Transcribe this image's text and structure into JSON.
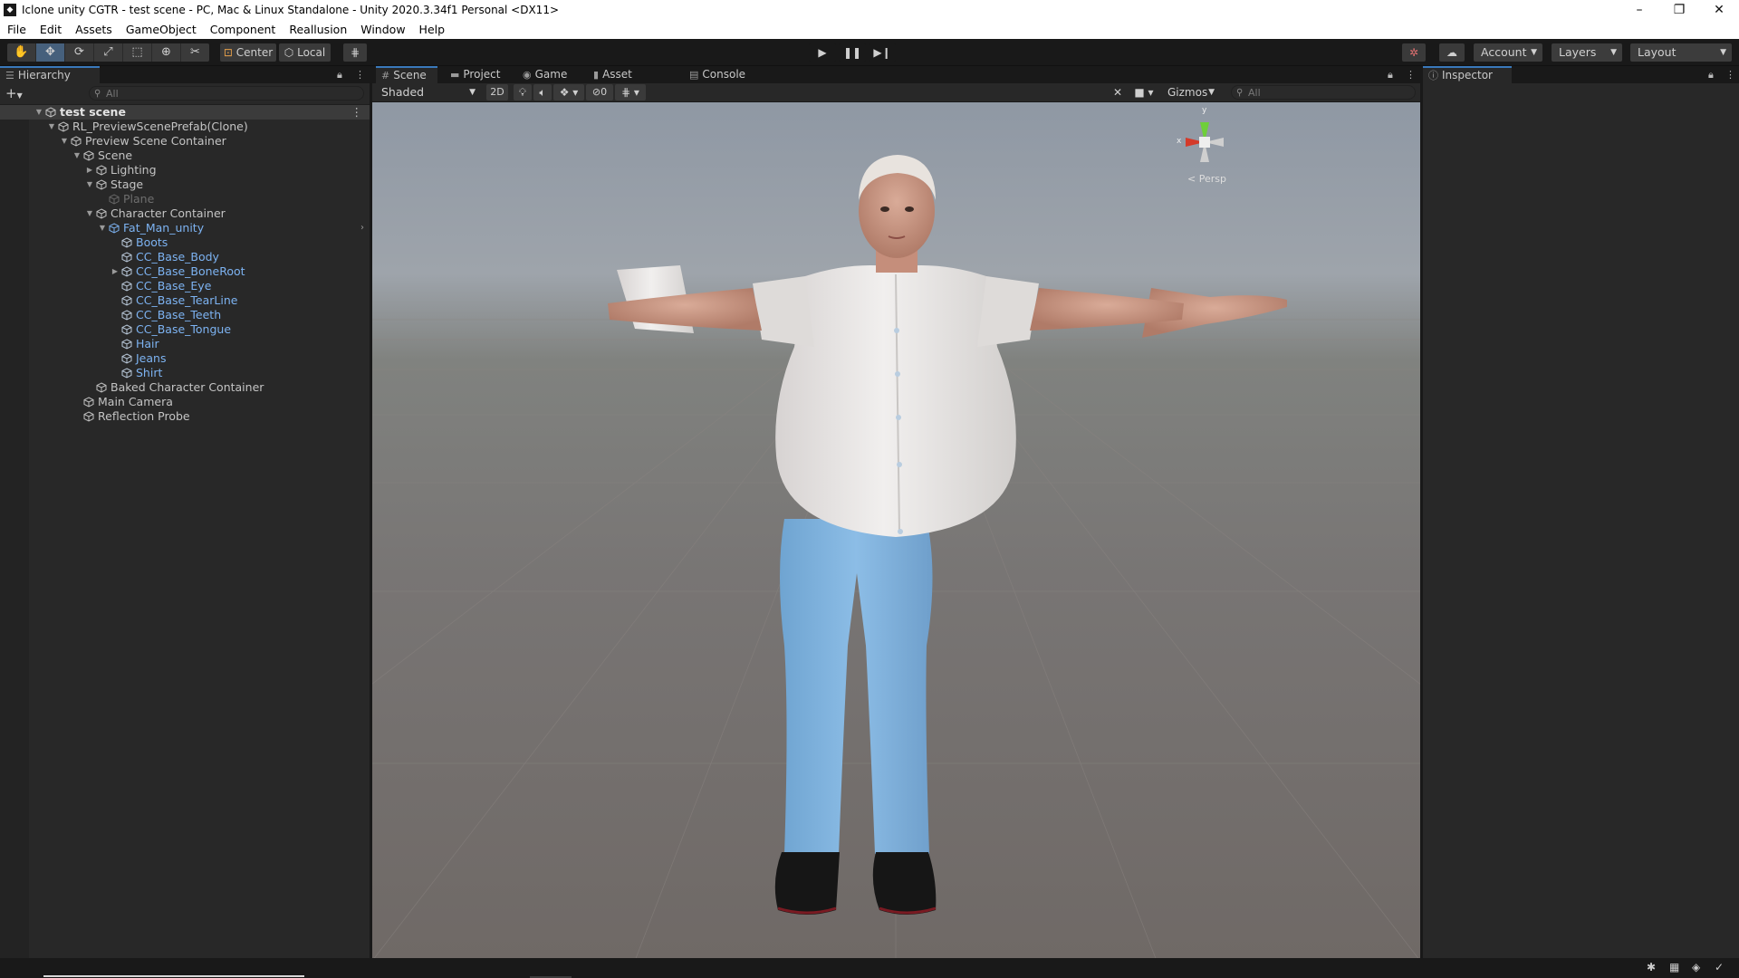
{
  "window": {
    "title": "Iclone unity CGTR - test scene - PC, Mac & Linux Standalone - Unity 2020.3.34f1 Personal <DX11>",
    "controls": [
      "–",
      "❐",
      "✕"
    ]
  },
  "menu": [
    "File",
    "Edit",
    "Assets",
    "GameObject",
    "Component",
    "Reallusion",
    "Window",
    "Help"
  ],
  "toolbar": {
    "pivot_label": "Center",
    "space_label": "Local",
    "account_label": "Account",
    "layers_label": "Layers",
    "layout_label": "Layout"
  },
  "hierarchy": {
    "tab_label": "Hierarchy",
    "search_placeholder": "All",
    "add_label": "+",
    "items": [
      {
        "label": "test scene",
        "depth": 0,
        "expanded": true,
        "style": "bold"
      },
      {
        "label": "RL_PreviewScenePrefab(Clone)",
        "depth": 1,
        "expanded": true,
        "style": "normal"
      },
      {
        "label": "Preview Scene Container",
        "depth": 2,
        "expanded": true,
        "style": "normal"
      },
      {
        "label": "Scene",
        "depth": 3,
        "expanded": true,
        "style": "normal"
      },
      {
        "label": "Lighting",
        "depth": 4,
        "expanded": false,
        "style": "normal"
      },
      {
        "label": "Stage",
        "depth": 4,
        "expanded": true,
        "style": "normal"
      },
      {
        "label": "Plane",
        "depth": 5,
        "expanded": null,
        "style": "dim"
      },
      {
        "label": "Character Container",
        "depth": 4,
        "expanded": true,
        "style": "normal"
      },
      {
        "label": "Fat_Man_unity",
        "depth": 5,
        "expanded": true,
        "style": "prefab"
      },
      {
        "label": "Boots",
        "depth": 6,
        "expanded": null,
        "style": "blue"
      },
      {
        "label": "CC_Base_Body",
        "depth": 6,
        "expanded": null,
        "style": "blue"
      },
      {
        "label": "CC_Base_BoneRoot",
        "depth": 6,
        "expanded": false,
        "style": "blue"
      },
      {
        "label": "CC_Base_Eye",
        "depth": 6,
        "expanded": null,
        "style": "blue"
      },
      {
        "label": "CC_Base_TearLine",
        "depth": 6,
        "expanded": null,
        "style": "blue"
      },
      {
        "label": "CC_Base_Teeth",
        "depth": 6,
        "expanded": null,
        "style": "blue"
      },
      {
        "label": "CC_Base_Tongue",
        "depth": 6,
        "expanded": null,
        "style": "blue"
      },
      {
        "label": "Hair",
        "depth": 6,
        "expanded": null,
        "style": "blue"
      },
      {
        "label": "Jeans",
        "depth": 6,
        "expanded": null,
        "style": "blue"
      },
      {
        "label": "Shirt",
        "depth": 6,
        "expanded": null,
        "style": "blue"
      },
      {
        "label": "Baked Character Container",
        "depth": 4,
        "expanded": null,
        "style": "normal"
      },
      {
        "label": "Main Camera",
        "depth": 3,
        "expanded": null,
        "style": "normal"
      },
      {
        "label": "Reflection Probe",
        "depth": 3,
        "expanded": null,
        "style": "normal"
      }
    ]
  },
  "scene": {
    "tabs": [
      {
        "label": "Scene",
        "icon": "#",
        "active": true
      },
      {
        "label": "Project",
        "icon": "▬",
        "active": false
      },
      {
        "label": "Game",
        "icon": "◉",
        "active": false
      },
      {
        "label": "Asset Store",
        "icon": "▮",
        "active": false
      },
      {
        "label": "Console",
        "icon": "▤",
        "active": false
      }
    ],
    "shading_mode": "Shaded",
    "toggle_2d": "2D",
    "hidden_count": "0",
    "gizmos_label": "Gizmos",
    "search_placeholder": "All",
    "projection_label": "< Persp",
    "axis_x": "x",
    "axis_y": "y"
  },
  "inspector": {
    "tab_label": "Inspector"
  },
  "colors": {
    "accent": "#3a79bb",
    "prefab_blue": "#7db3f2",
    "shirt": "#e7e4e3",
    "jeans": "#7fb2de",
    "skin": "#cf9d8b"
  }
}
